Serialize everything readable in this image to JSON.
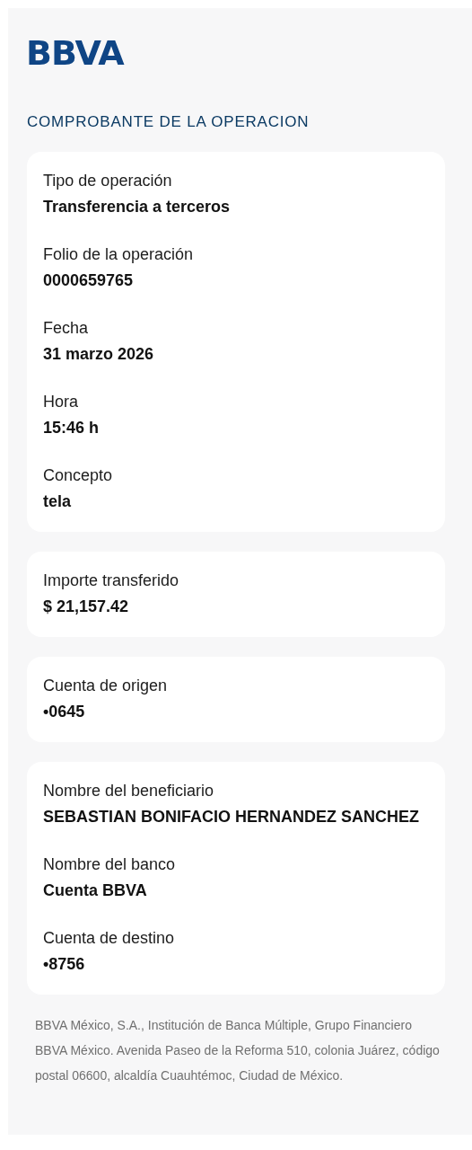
{
  "logo": "BBVA",
  "title": "COMPROBANTE DE LA OPERACION",
  "cards": [
    {
      "fields": [
        {
          "label": "Tipo de operación",
          "value": "Transferencia a terceros"
        },
        {
          "label": "Folio de la operación",
          "value": "0000659765"
        },
        {
          "label": "Fecha",
          "value": "31 marzo 2026"
        },
        {
          "label": "Hora",
          "value": "15:46 h"
        },
        {
          "label": "Concepto",
          "value": "tela"
        }
      ]
    },
    {
      "fields": [
        {
          "label": "Importe transferido",
          "value": "$ 21,157.42"
        }
      ]
    },
    {
      "fields": [
        {
          "label": "Cuenta de origen",
          "value": "•0645"
        }
      ]
    },
    {
      "fields": [
        {
          "label": "Nombre del beneficiario",
          "value": "SEBASTIAN BONIFACIO HERNANDEZ SANCHEZ"
        },
        {
          "label": "Nombre del banco",
          "value": "Cuenta BBVA"
        },
        {
          "label": "Cuenta de destino",
          "value": "•8756"
        }
      ]
    }
  ],
  "footer": "BBVA México, S.A., Institución de Banca Múltiple, Grupo Financiero BBVA México. Avenida Paseo de la Reforma 510, colonia Juárez, código postal 06600, alcaldía Cuauhtémoc, Ciudad de México."
}
